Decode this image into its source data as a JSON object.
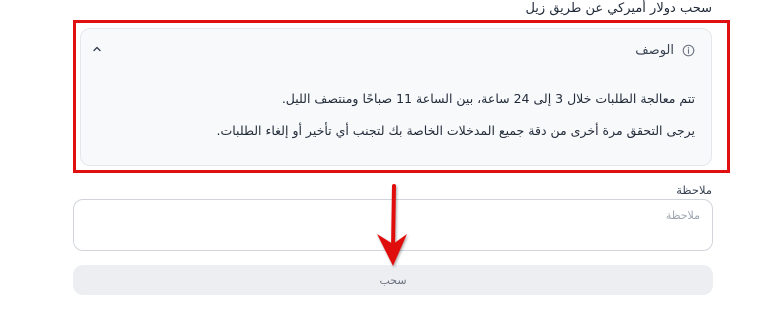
{
  "section": {
    "title": "سحب دولار أميركي عن طريق زيل"
  },
  "description": {
    "title": "الوصف",
    "line1": "تتم معالجة الطلبات خلال 3 إلى 24 ساعة، بين الساعة 11 صباحًا ومنتصف الليل.",
    "line2": "يرجى التحقق مرة أخرى من دقة جميع المدخلات الخاصة بك لتجنب أي تأخير أو إلغاء الطلبات.",
    "info_icon": "info-icon",
    "toggle_icon": "chevron-up-icon"
  },
  "note": {
    "label": "ملاحظة",
    "placeholder": "ملاحظة",
    "value": ""
  },
  "actions": {
    "withdraw_label": "سحب"
  },
  "annotation": {
    "highlight_color": "#e01010",
    "arrow_color": "#e01010"
  }
}
